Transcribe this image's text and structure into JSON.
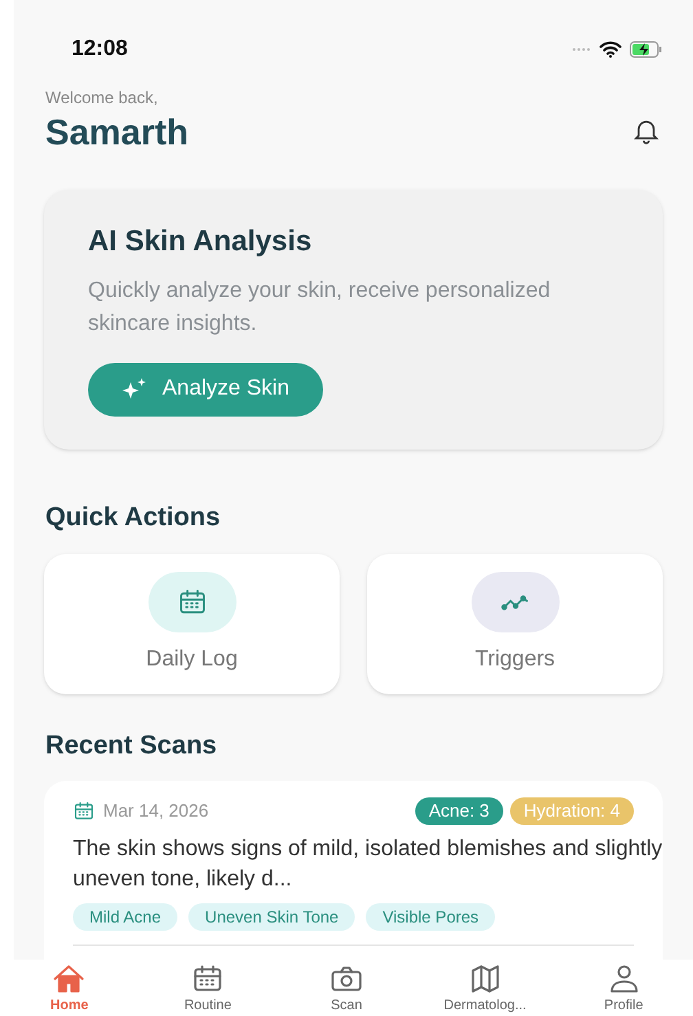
{
  "status_bar": {
    "time": "12:08"
  },
  "header": {
    "greeting": "Welcome back,",
    "name": "Samarth"
  },
  "analysis_card": {
    "title": "AI Skin Analysis",
    "description": "Quickly analyze your skin, receive personalized skincare insights.",
    "button": "Analyze Skin"
  },
  "quick_actions": {
    "title": "Quick Actions",
    "items": [
      {
        "kind": "calendar",
        "label": "Daily Log",
        "color": "#dff5f3"
      },
      {
        "kind": "trend",
        "label": "Triggers",
        "color": "#e9e9f3"
      }
    ]
  },
  "recent_scans": {
    "title": "Recent Scans",
    "scans": [
      {
        "date": "Mar 14, 2026",
        "scores": [
          {
            "label": "Acne: 3",
            "color": "#2a9d8a"
          },
          {
            "label": "Hydration: 4",
            "color": "#e9c46a"
          }
        ],
        "summary": "The skin shows signs of mild, isolated blemishes and slightly uneven tone, likely d...",
        "tags": [
          "Mild Acne",
          "Uneven Skin Tone",
          "Visible Pores"
        ]
      }
    ]
  },
  "tab_bar": [
    {
      "kind": "home",
      "label": "Home",
      "selected": true
    },
    {
      "kind": "calendar",
      "label": "Routine",
      "selected": false
    },
    {
      "kind": "camera",
      "label": "Scan",
      "selected": false
    },
    {
      "kind": "map",
      "label": "Dermatolog...",
      "selected": false
    },
    {
      "kind": "person",
      "label": "Profile",
      "selected": false
    }
  ]
}
